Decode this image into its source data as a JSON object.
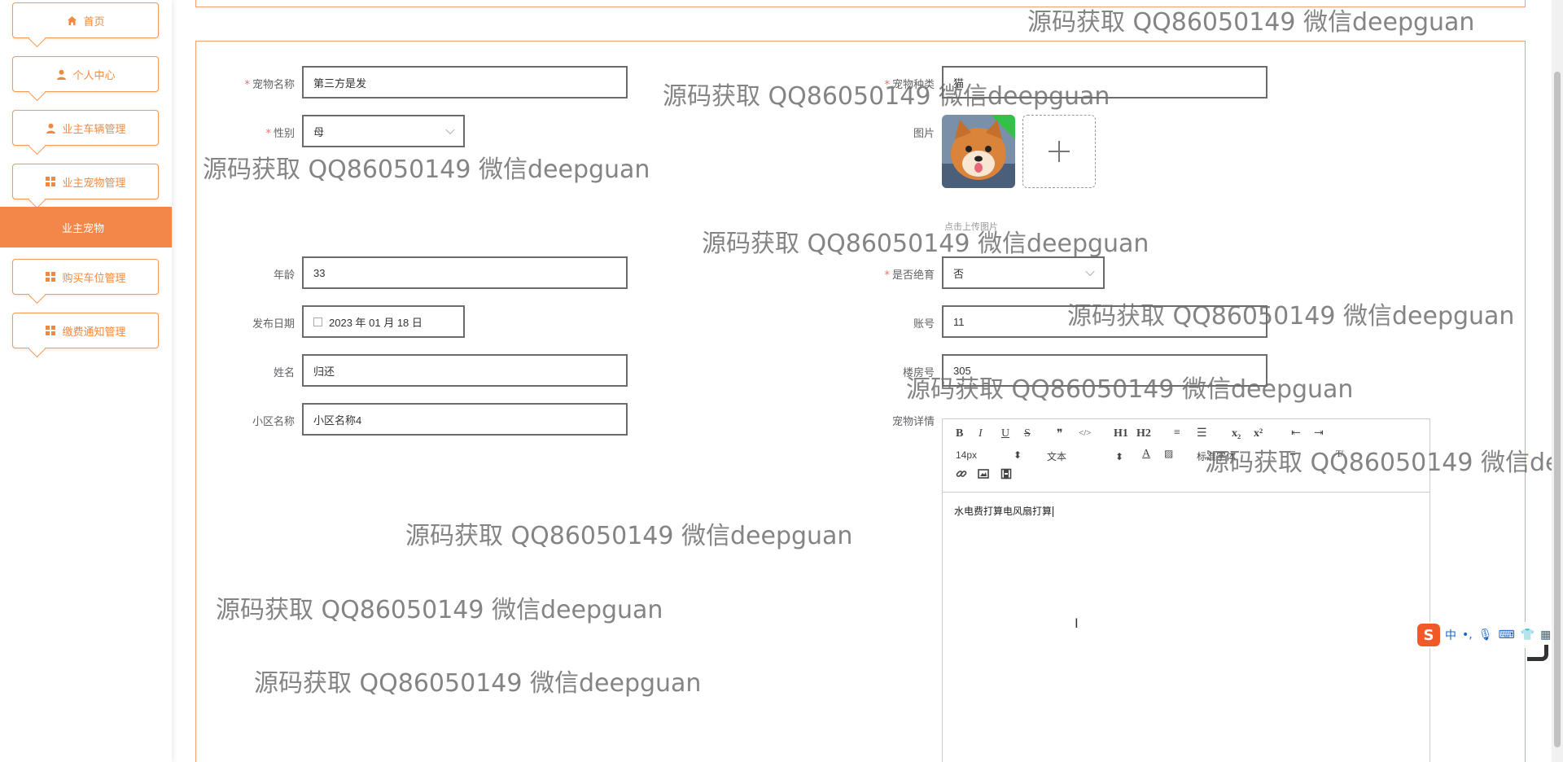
{
  "sidebar": {
    "items": [
      {
        "label": "首页",
        "icon": "home-icon"
      },
      {
        "label": "个人中心",
        "icon": "user-icon"
      },
      {
        "label": "业主车辆管理",
        "icon": "user-icon"
      },
      {
        "label": "业主宠物管理",
        "icon": "grid-icon"
      },
      {
        "label": "购买车位管理",
        "icon": "grid-icon"
      },
      {
        "label": "缴费通知管理",
        "icon": "grid-icon"
      }
    ],
    "active_sub": "业主宠物",
    "accent": "#f3874a"
  },
  "form": {
    "pet_name": {
      "label": "宠物名称",
      "value": "第三方是发"
    },
    "pet_type": {
      "label": "宠物种类",
      "value": "猫"
    },
    "gender": {
      "label": "性别",
      "value": "母"
    },
    "image": {
      "label": "图片",
      "tip": "点击上传图片"
    },
    "age": {
      "label": "年龄",
      "value": "33"
    },
    "neutered": {
      "label": "是否绝育",
      "value": "否"
    },
    "publish_date": {
      "label": "发布日期",
      "value": "2023 年 01 月 18 日"
    },
    "account": {
      "label": "账号",
      "value": "11"
    },
    "name": {
      "label": "姓名",
      "value": "归还"
    },
    "room": {
      "label": "楼房号",
      "value": "305"
    },
    "community": {
      "label": "小区名称",
      "value": "小区名称4"
    },
    "details": {
      "label": "宠物详情",
      "content": "水电费打算电风扇打算"
    }
  },
  "editor": {
    "row1": [
      "B",
      "I",
      "U",
      "S",
      "❞",
      "</>",
      "H1",
      "H2",
      "≡",
      "☰",
      "x₂",
      "x²",
      "⇤",
      "⇥"
    ],
    "font_size": "14px",
    "font_type": "文本",
    "header": "标准字体"
  },
  "watermark": "源码获取 QQ86050149 微信deepguan",
  "ime": {
    "lang": "中",
    "punct": "•,"
  }
}
